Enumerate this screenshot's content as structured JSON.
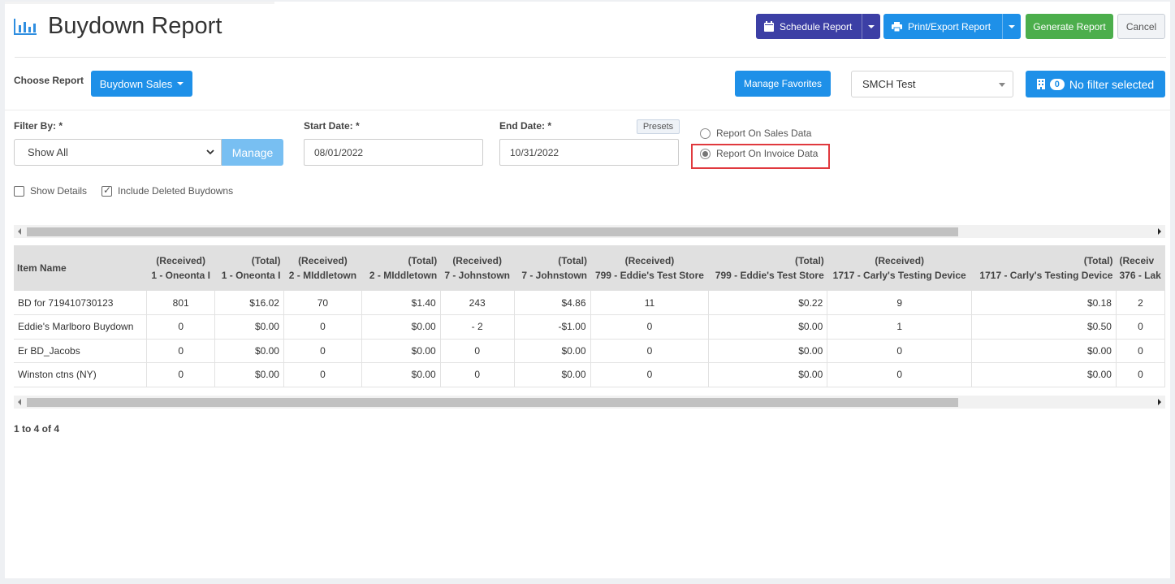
{
  "header": {
    "title": "Buydown Report",
    "schedule_label": "Schedule Report",
    "print_label": "Print/Export Report",
    "generate_label": "Generate Report",
    "cancel_label": "Cancel"
  },
  "toolbar": {
    "choose_report_label": "Choose Report",
    "report_type": "Buydown Sales",
    "manage_favorites_label": "Manage Favorites",
    "store_selected": "SMCH Test",
    "filter_count": "0",
    "filter_label": "No filter selected"
  },
  "filters": {
    "filter_by_label": "Filter By: *",
    "filter_by_value": "Show All",
    "manage_label": "Manage",
    "start_date_label": "Start Date: *",
    "start_date_value": "08/01/2022",
    "end_date_label": "End Date: *",
    "end_date_value": "10/31/2022",
    "presets_label": "Presets",
    "radio_sales_label": "Report On Sales Data",
    "radio_invoice_label": "Report On Invoice Data",
    "selected_radio": "invoice",
    "show_details_label": "Show Details",
    "show_details_checked": false,
    "include_deleted_label": "Include Deleted Buydowns",
    "include_deleted_checked": true
  },
  "table": {
    "columns": [
      {
        "line1": "Item Name",
        "line2": "",
        "align": "left"
      },
      {
        "line1": "(Received)",
        "line2": "1 - Oneonta I",
        "align": "center"
      },
      {
        "line1": "(Total)",
        "line2": "1 - Oneonta I",
        "align": "right"
      },
      {
        "line1": "(Received)",
        "line2": "2 - MIddletown",
        "align": "center"
      },
      {
        "line1": "(Total)",
        "line2": "2 - MIddletown",
        "align": "right"
      },
      {
        "line1": "(Received)",
        "line2": "7 - Johnstown",
        "align": "center"
      },
      {
        "line1": "(Total)",
        "line2": "7 - Johnstown",
        "align": "right"
      },
      {
        "line1": "(Received)",
        "line2": "799 - Eddie's Test Store",
        "align": "center"
      },
      {
        "line1": "(Total)",
        "line2": "799 - Eddie's Test Store",
        "align": "right"
      },
      {
        "line1": "(Received)",
        "line2": "1717 - Carly's Testing Device",
        "align": "center"
      },
      {
        "line1": "(Total)",
        "line2": "1717 - Carly's Testing Device",
        "align": "right"
      },
      {
        "line1": "(Receiv",
        "line2": "376 - Lak",
        "align": "left"
      }
    ],
    "rows": [
      [
        "BD for 719410730123",
        "801",
        "$16.02",
        "70",
        "$1.40",
        "243",
        "$4.86",
        "11",
        "$0.22",
        "9",
        "$0.18",
        "2"
      ],
      [
        "Eddie's Marlboro Buydown",
        "0",
        "$0.00",
        "0",
        "$0.00",
        "- 2",
        "-$1.00",
        "0",
        "$0.00",
        "1",
        "$0.50",
        "0"
      ],
      [
        "Er BD_Jacobs",
        "0",
        "$0.00",
        "0",
        "$0.00",
        "0",
        "$0.00",
        "0",
        "$0.00",
        "0",
        "$0.00",
        "0"
      ],
      [
        "Winston ctns (NY)",
        "0",
        "$0.00",
        "0",
        "$0.00",
        "0",
        "$0.00",
        "0",
        "$0.00",
        "0",
        "$0.00",
        "0"
      ]
    ]
  },
  "pager": {
    "text": "1 to 4 of 4"
  },
  "colors": {
    "primary": "#1e90e8",
    "schedule": "#3c3fa5",
    "generate": "#4cae4c",
    "highlight": "#e0393e"
  },
  "icons": {
    "title": "bar-chart-icon",
    "schedule": "calendar-icon",
    "print": "printer-icon",
    "filter": "building-icon"
  }
}
